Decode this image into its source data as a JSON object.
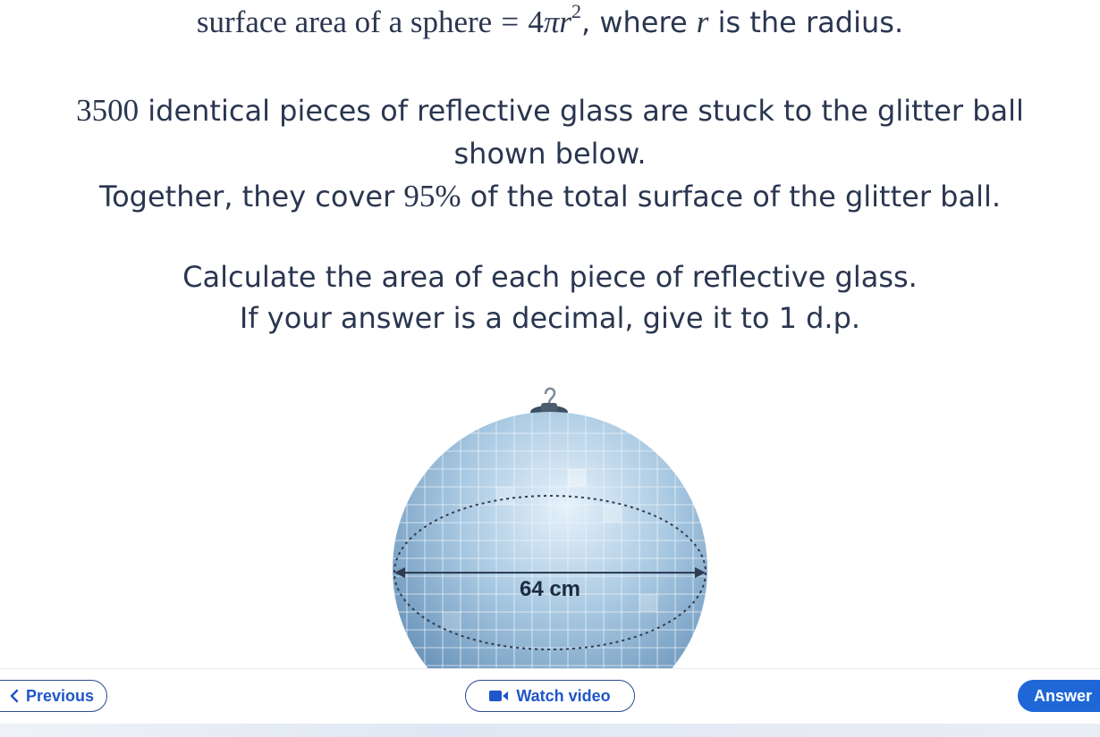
{
  "question": {
    "formula_line": {
      "label": "surface area of a sphere",
      "equals": "=",
      "coefficient": "4",
      "pi": "π",
      "variable": "r",
      "exponent": "2",
      "suffix_1": ", where",
      "suffix_var": "r",
      "suffix_2": "is the radius."
    },
    "line_2": {
      "number": "3500",
      "text": "identical pieces of reflective glass are stuck to the glitter ball"
    },
    "line_3": "shown below.",
    "line_4": {
      "before": "Together, they cover",
      "percent": "95%",
      "after": "of the total surface of the glitter ball."
    },
    "line_5": "Calculate the area of each piece of reflective glass.",
    "line_6": "If your answer is a decimal, give it to 1 d.p."
  },
  "figure": {
    "diameter_label": "64 cm",
    "icon": "glitter-ball"
  },
  "nav": {
    "previous_label": "Previous",
    "previous_icon": "chevron-left-icon",
    "video_label": "Watch video",
    "video_icon": "video-camera-icon",
    "answer_label": "Answer"
  },
  "colors": {
    "text": "#2a3650",
    "button_text": "#1f56c9",
    "answer_bg": "#1f67d6"
  }
}
